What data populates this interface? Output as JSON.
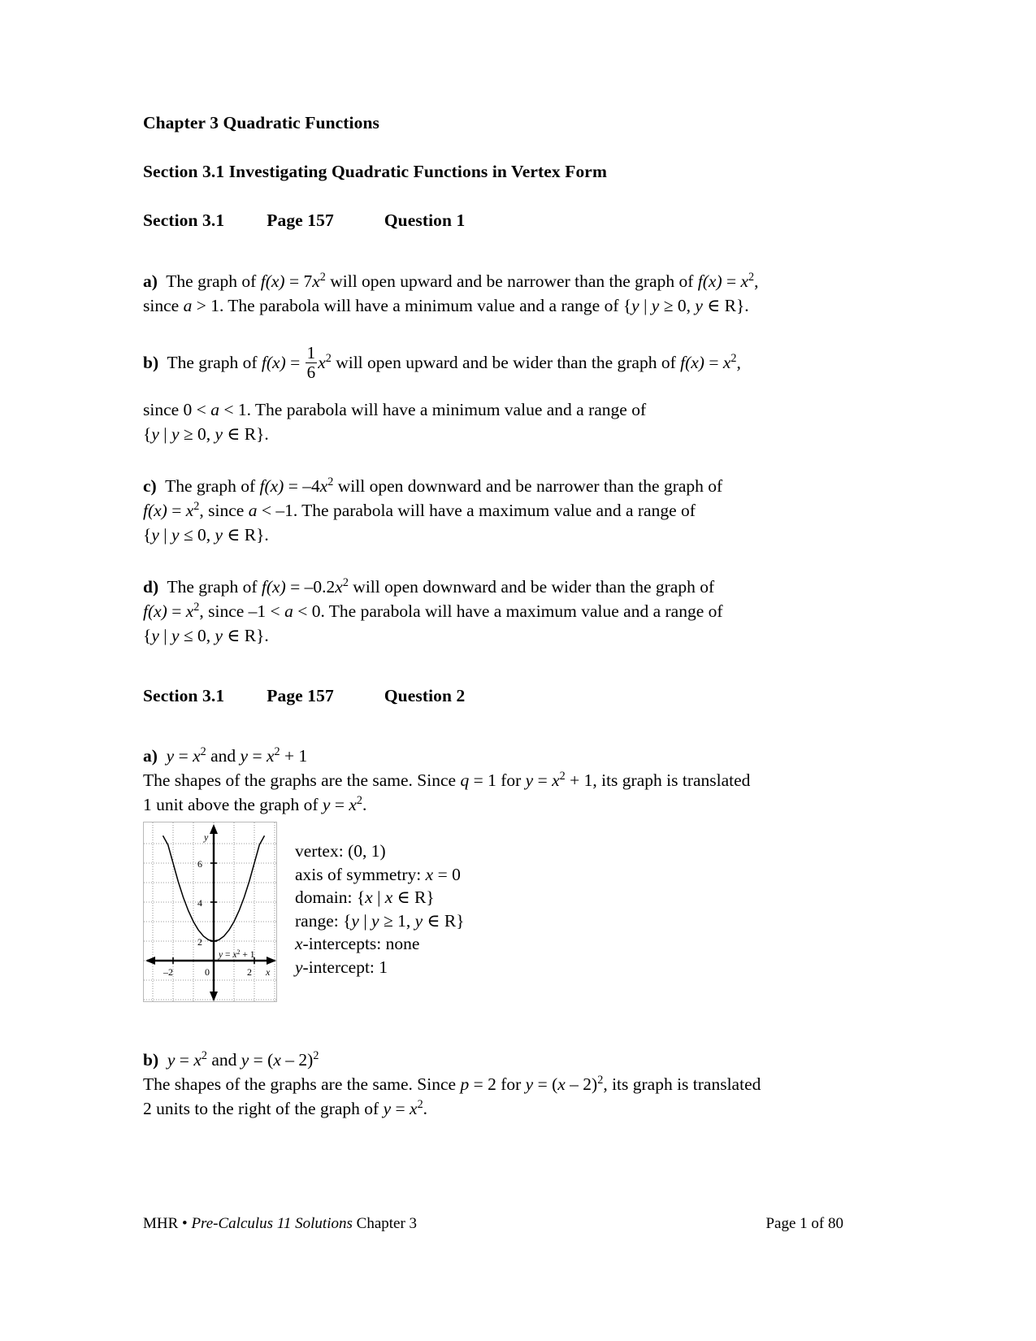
{
  "document": {
    "chapter_heading": "Chapter 3 Quadratic Functions",
    "section_heading": "Section 3.1 Investigating Quadratic Functions in Vertex Form"
  },
  "question1": {
    "header": {
      "section": "Section 3.1",
      "page": "Page 157",
      "question": "Question 1"
    },
    "parts": {
      "a": {
        "label": "a)",
        "line1_pre": "The graph of ",
        "fn": "f(x)",
        "eq": " = 7",
        "var": "x",
        "exp": "2",
        "line1_post": " will open upward and be narrower than the graph of ",
        "fn2": "f(x)",
        "eq2": " = ",
        "var2": "x",
        "exp2": "2",
        "comma": ",",
        "line2_a": "since ",
        "line2_var": "a",
        "line2_b": " > 1. The parabola will have a minimum value and a range of {",
        "line2_y1": "y",
        "line2_c": " | ",
        "line2_y2": "y",
        "line2_d": " ≥ 0, ",
        "line2_y3": "y",
        "line2_e": " ∈ R}."
      },
      "b": {
        "label": "b)",
        "line1_pre": "The graph of ",
        "fn": "f(x)",
        "eq": " = ",
        "frac_num": "1",
        "frac_den": "6",
        "var": "x",
        "exp": "2",
        "line1_post": " will open upward and be wider than the graph of ",
        "fn2": "f(x)",
        "eq2": " = ",
        "var2": "x",
        "exp2": "2",
        "comma": ",",
        "line2_a": "since 0 < ",
        "line2_var": "a",
        "line2_b": " < 1. The parabola will have a minimum value and a range of",
        "line3_a": "{",
        "line3_y1": "y",
        "line3_b": " | ",
        "line3_y2": "y",
        "line3_c": " ≥ 0, ",
        "line3_y3": "y",
        "line3_d": " ∈ R}."
      },
      "c": {
        "label": "c)",
        "line1_pre": "The graph of ",
        "fn": "f(x)",
        "eq": " = –4",
        "var": "x",
        "exp": "2",
        "line1_post": " will open downward and be narrower than the graph of",
        "line2_fn": "f(x)",
        "line2_eq": " = ",
        "line2_var": "x",
        "line2_exp": "2",
        "line2_a": ", since ",
        "line2_avar": "a",
        "line2_b": " < –1. The parabola will have a maximum value and a range of",
        "line3_a": "{",
        "line3_y1": "y",
        "line3_b": " | ",
        "line3_y2": "y",
        "line3_c": " ≤ 0, ",
        "line3_y3": "y",
        "line3_d": " ∈ R}."
      },
      "d": {
        "label": "d)",
        "line1_pre": "The graph of ",
        "fn": "f(x)",
        "eq": " = –0.2",
        "var": "x",
        "exp": "2",
        "line1_post": " will open downward and be wider than the graph of",
        "line2_fn": "f(x)",
        "line2_eq": " = ",
        "line2_var": "x",
        "line2_exp": "2",
        "line2_a": ", since –1 < ",
        "line2_avar": "a",
        "line2_b": " < 0. The parabola will have a maximum value and a range of",
        "line3_a": "{",
        "line3_y1": "y",
        "line3_b": " | ",
        "line3_y2": "y",
        "line3_c": " ≤ 0, ",
        "line3_y3": "y",
        "line3_d": " ∈ R}."
      }
    }
  },
  "question2": {
    "header": {
      "section": "Section 3.1",
      "page": "Page 157",
      "question": "Question 2"
    },
    "parts": {
      "a": {
        "label": "a)",
        "title_y1": "y",
        "title_eq1": " = ",
        "title_x1": "x",
        "title_exp1": "2",
        "title_and": " and ",
        "title_y2": "y",
        "title_eq2": " = ",
        "title_x2": "x",
        "title_exp2": "2",
        "title_plus": " + 1",
        "body1_a": "The shapes of the graphs are the same. Since ",
        "body1_q": "q",
        "body1_b": " = 1 for ",
        "body1_y": "y",
        "body1_c": " = ",
        "body1_x": "x",
        "body1_exp": "2",
        "body1_d": " + 1, its graph is translated",
        "body2_a": "1 unit above the graph of ",
        "body2_y": "y",
        "body2_b": " = ",
        "body2_x": "x",
        "body2_exp": "2",
        "body2_c": ".",
        "properties": {
          "vertex": "vertex: (0, 1)",
          "axis_of_symmetry_pre": "axis of symmetry: ",
          "axis_of_symmetry_var": "x",
          "axis_of_symmetry_post": " = 0",
          "domain_pre": "domain: {",
          "domain_x1": "x",
          "domain_mid": " | ",
          "domain_x2": "x",
          "domain_post": " ∈ R}",
          "range_pre": "range: {",
          "range_y1": "y",
          "range_mid": " | ",
          "range_y2": "y",
          "range_cmp": " ≥ 1, ",
          "range_y3": "y",
          "range_post": " ∈ R}",
          "x_intercepts_var": "x",
          "x_intercepts_text": "-intercepts: none",
          "y_intercept_var": "y",
          "y_intercept_text": "-intercept: 1"
        }
      },
      "b": {
        "label": "b)",
        "title_y1": "y",
        "title_eq1": " = ",
        "title_x1": "x",
        "title_exp1": "2",
        "title_and": " and ",
        "title_y2": "y",
        "title_eq2": " = (",
        "title_x2": "x",
        "title_minus": " – 2)",
        "title_exp2": "2",
        "body1_a": "The shapes of the graphs are the same. Since ",
        "body1_p": "p",
        "body1_b": " = 2 for ",
        "body1_y": "y",
        "body1_c": " = (",
        "body1_x": "x",
        "body1_d": " – 2)",
        "body1_exp": "2",
        "body1_e": ", its graph is translated",
        "body2_a": "2 units to the right of the graph of ",
        "body2_y": "y",
        "body2_b": " = ",
        "body2_x": "x",
        "body2_exp": "2",
        "body2_c": "."
      }
    }
  },
  "graph": {
    "curve_label_y": "y",
    "curve_label_eq": " = ",
    "curve_label_x": "x",
    "curve_label_exp": "2",
    "curve_label_plus": " + 1",
    "y_axis_label": "y",
    "x_axis_label": "x",
    "y_ticks": [
      "6",
      "4",
      "2"
    ],
    "x_ticks": [
      "–2",
      "0",
      "2"
    ]
  },
  "chart_data": {
    "type": "line",
    "title": "y = x² + 1",
    "xlabel": "x",
    "ylabel": "y",
    "xlim": [
      -3.2,
      3.2
    ],
    "ylim": [
      -1.2,
      7.6
    ],
    "x_ticks": [
      -2,
      0,
      2
    ],
    "y_ticks": [
      2,
      4,
      6
    ],
    "grid": true,
    "series": [
      {
        "name": "y = x^2 + 1",
        "x": [
          -2.5,
          -2.25,
          -2,
          -1.75,
          -1.5,
          -1.25,
          -1,
          -0.75,
          -0.5,
          -0.25,
          0,
          0.25,
          0.5,
          0.75,
          1,
          1.25,
          1.5,
          1.75,
          2,
          2.25,
          2.5
        ],
        "y": [
          7.25,
          6.0625,
          5,
          4.0625,
          3.25,
          2.5625,
          2,
          1.5625,
          1.25,
          1.0625,
          1,
          1.0625,
          1.25,
          1.5625,
          2,
          2.5625,
          3.25,
          4.0625,
          5,
          6.0625,
          7.25
        ]
      }
    ],
    "annotations": [
      {
        "text": "vertex: (0, 1)",
        "x": 0,
        "y": 1
      }
    ]
  },
  "footer": {
    "prefix": "MHR • ",
    "italic": "Pre-Calculus 11 Solutions",
    "suffix": " Chapter 3",
    "page_number": "Page 1 of 80"
  }
}
